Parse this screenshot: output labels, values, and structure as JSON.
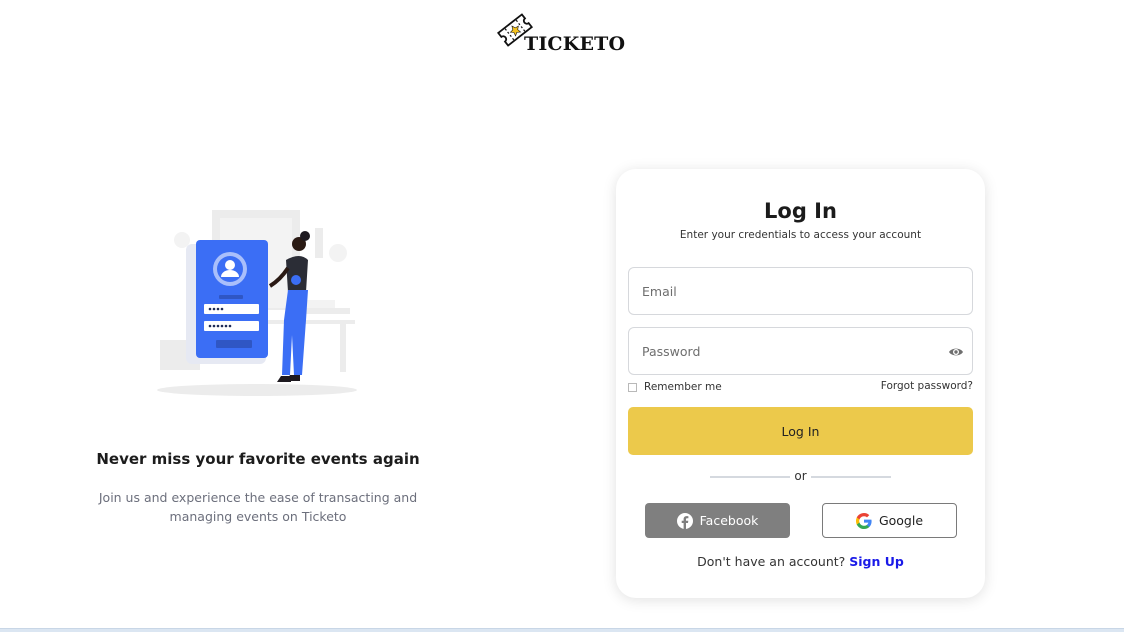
{
  "brand": {
    "name": "TICKETO",
    "logo_icon": "ticket-icon",
    "accent": "#f4c21f"
  },
  "hero": {
    "illustration": "person-login-illustration",
    "headline": "Never miss your favorite events again",
    "description": "Join us and experience the ease of transacting and managing events on Ticketo",
    "accent_color": "#3b6ef5"
  },
  "login": {
    "title": "Log In",
    "subtitle": "Enter your credentials to access your account",
    "email_placeholder": "Email",
    "password_placeholder": "Password",
    "show_password_icon": "eye-icon",
    "remember_label": "Remember me",
    "forgot_label": "Forgot password?",
    "submit_label": "Log In",
    "submit_color": "#ecc94b",
    "divider_label": "or",
    "facebook_label": "Facebook",
    "google_label": "Google",
    "no_account_text": "Don't have an account?",
    "signup_label": "Sign Up"
  }
}
